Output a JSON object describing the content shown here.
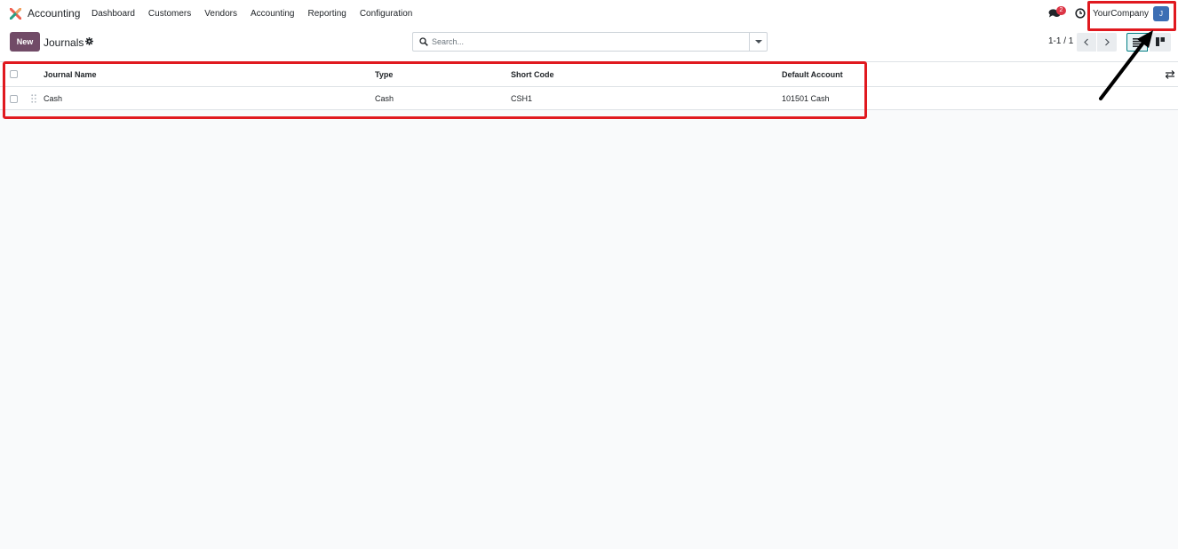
{
  "navbar": {
    "app_name": "Accounting",
    "menu": [
      "Dashboard",
      "Customers",
      "Vendors",
      "Accounting",
      "Reporting",
      "Configuration"
    ],
    "messages_badge": "2",
    "company": "YourCompany",
    "avatar_initial": "J"
  },
  "control_panel": {
    "new_label": "New",
    "breadcrumb": "Journals",
    "search_placeholder": "Search...",
    "pager": "1-1 / 1"
  },
  "table": {
    "columns": [
      "Journal Name",
      "Type",
      "Short Code",
      "Default Account"
    ],
    "rows": [
      [
        "Cash",
        "Cash",
        "CSH1",
        "101501 Cash"
      ]
    ]
  },
  "colors": {
    "brand": "#714b67",
    "highlight": "#e0191f",
    "avatar": "#3c6eb4",
    "badge": "#dc3545"
  }
}
